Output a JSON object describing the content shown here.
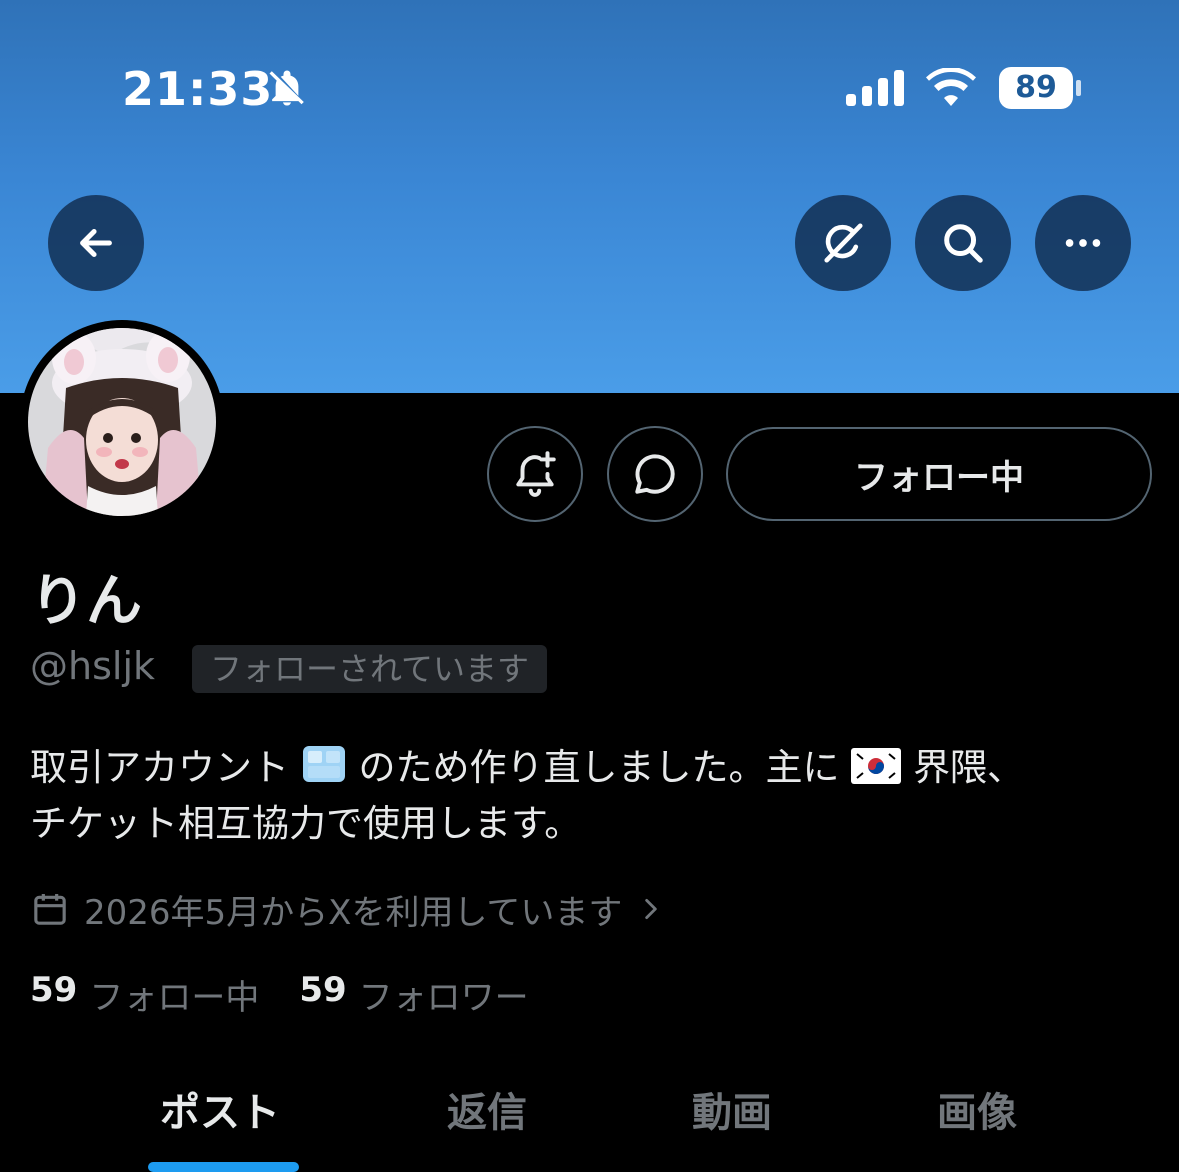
{
  "status_bar": {
    "time": "21:33",
    "battery": "89"
  },
  "profile": {
    "display_name": "りん",
    "handle": "@hsljk",
    "follows_you_badge": "フォローされています",
    "bio_line1_a": "取引アカウント",
    "bio_line1_b": "のため作り直しました。主に",
    "bio_line1_c": "界隈、",
    "bio_line2": "チケット相互協力で使用します。",
    "joined": "2026年5月からXを利用しています",
    "following_count": "59",
    "following_label": "フォロー中",
    "followers_count": "59",
    "followers_label": "フォロワー"
  },
  "actions": {
    "follow_button": "フォロー中"
  },
  "tabs": [
    {
      "label": "ポスト",
      "active": true
    },
    {
      "label": "返信",
      "active": false
    },
    {
      "label": "動画",
      "active": false
    },
    {
      "label": "画像",
      "active": false
    }
  ],
  "colors": {
    "accent": "#1d9bf0",
    "banner": "#3a86d4"
  }
}
